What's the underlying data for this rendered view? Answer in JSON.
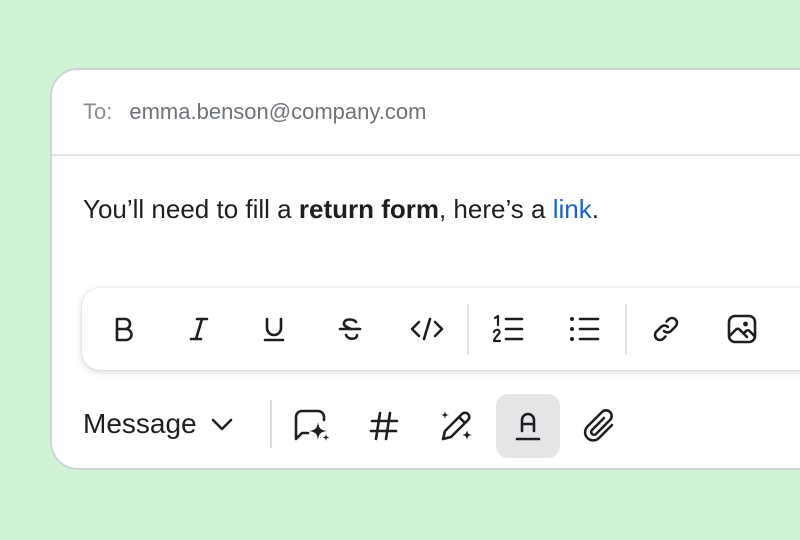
{
  "recipient": {
    "label": "To:",
    "value": "emma.benson@company.com"
  },
  "message": {
    "part1": "You’ll need to fill a ",
    "bold": "return form",
    "part2": ", here’s a ",
    "link": "link",
    "part3": "."
  },
  "format_toolbar": {
    "buttons": [
      "bold-icon",
      "italic-icon",
      "underline-icon",
      "strikethrough-icon",
      "code-icon",
      "numbered-list-icon",
      "bullet-list-icon",
      "link-icon",
      "image-icon"
    ]
  },
  "bottom_toolbar": {
    "message_type": "Message",
    "buttons": [
      "ai-chat-icon",
      "hash-icon",
      "magic-pen-icon",
      "text-color-icon",
      "attachment-icon"
    ],
    "active": "text-color-icon"
  },
  "colors": {
    "background": "#d0f2d4",
    "link": "#1a63c9",
    "active_button": "#e4e5e7"
  }
}
